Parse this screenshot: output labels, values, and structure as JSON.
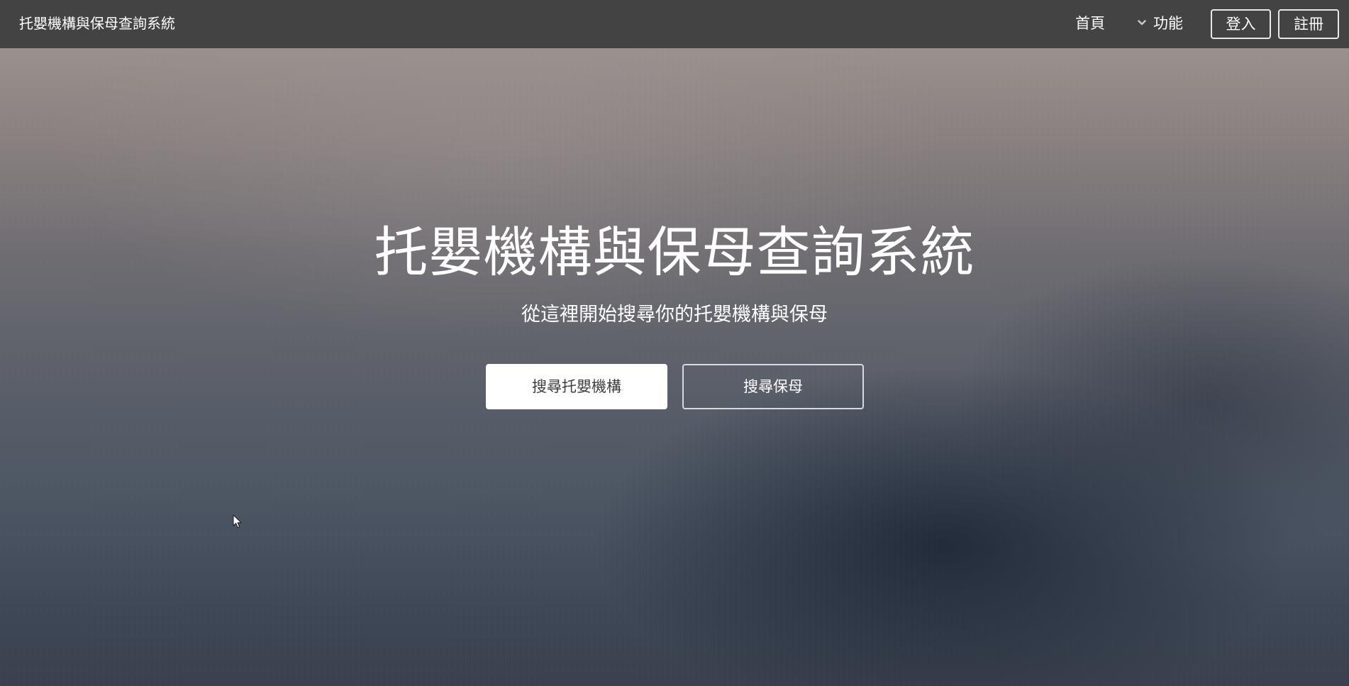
{
  "navbar": {
    "brand": "托嬰機構與保母查詢系統",
    "home_label": "首頁",
    "features_label": "功能",
    "features_icon": "chevron-down-icon",
    "login_label": "登入",
    "register_label": "註冊"
  },
  "hero": {
    "title": "托嬰機構與保母查詢系統",
    "subtitle": "從這裡開始搜尋你的托嬰機構與保母",
    "search_centers_label": "搜尋托嬰機構",
    "search_nannies_label": "搜尋保母"
  },
  "colors": {
    "navbar_bg": "#434343",
    "text": "#ffffff",
    "primary_button_bg": "#ffffff",
    "primary_button_text": "#3d3d3d"
  }
}
